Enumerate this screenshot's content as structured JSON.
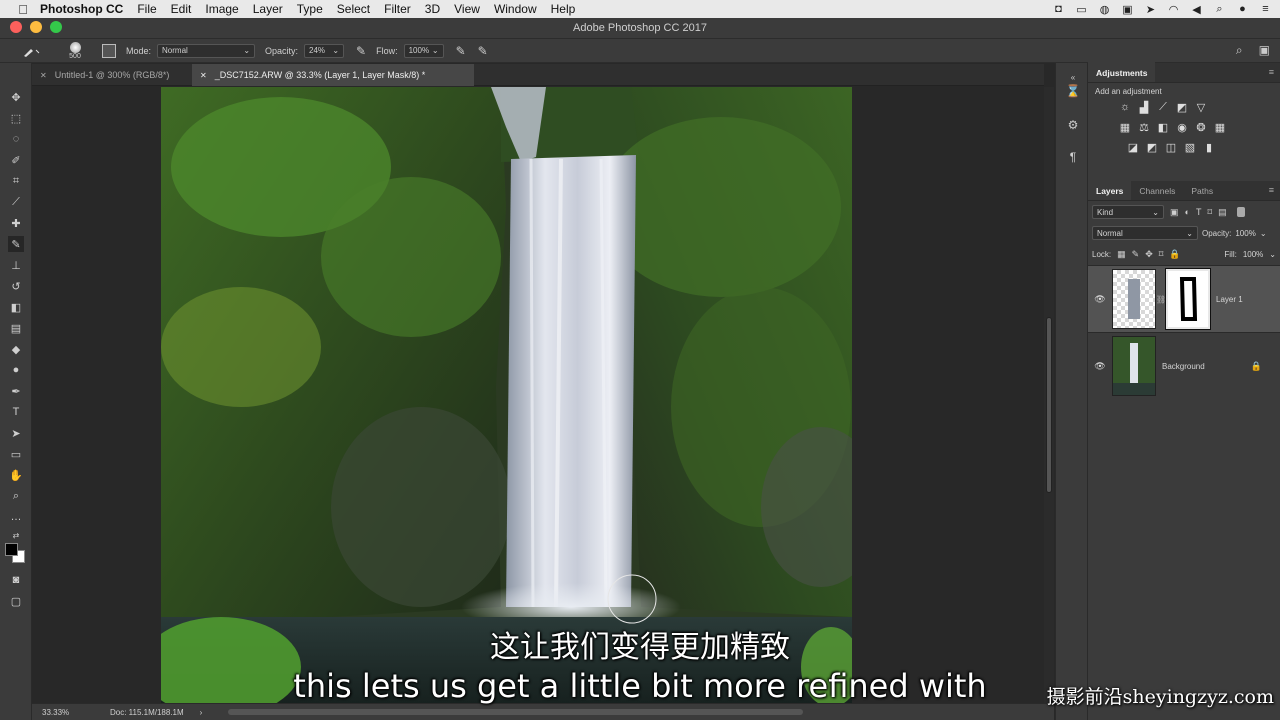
{
  "menubar": {
    "app_name": "Photoshop CC",
    "items": [
      "File",
      "Edit",
      "Image",
      "Layer",
      "Type",
      "Select",
      "Filter",
      "3D",
      "View",
      "Window",
      "Help"
    ]
  },
  "window": {
    "title": "Adobe Photoshop CC 2017"
  },
  "options": {
    "brush_size": "500",
    "mode_label": "Mode:",
    "mode_value": "Normal",
    "opacity_label": "Opacity:",
    "opacity_value": "24%",
    "flow_label": "Flow:",
    "flow_value": "100%"
  },
  "tabs": [
    {
      "label": "Untitled-1 @ 300% (RGB/8*)"
    },
    {
      "label": "_DSC7152.ARW @ 33.3% (Layer 1, Layer Mask/8) *"
    }
  ],
  "status": {
    "zoom": "33.33%",
    "doc": "Doc: 115.1M/188.1M",
    "arrow": "›"
  },
  "adjustments": {
    "tab": "Adjustments",
    "add_label": "Add an adjustment"
  },
  "layers_panel": {
    "tabs": [
      "Layers",
      "Channels",
      "Paths"
    ],
    "kind_label": "Kind",
    "blend_mode": "Normal",
    "opacity_label": "Opacity:",
    "opacity_value": "100%",
    "lock_label": "Lock:",
    "fill_label": "Fill:",
    "fill_value": "100%",
    "layers": [
      {
        "name": "Layer 1",
        "selected": true
      },
      {
        "name": "Background",
        "locked": true
      }
    ]
  },
  "subtitles": {
    "chinese": "这让我们变得更加精致",
    "english": "this lets us get a little bit more refined with"
  },
  "watermark": "摄影前沿sheyingzyz.com",
  "colors": {
    "foreground": "#000000",
    "background": "#ffffff"
  }
}
